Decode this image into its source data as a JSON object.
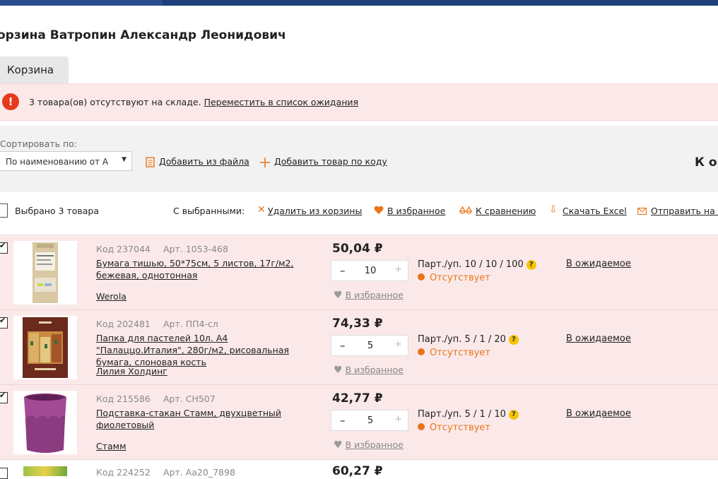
{
  "page": {
    "title": "орзина Ватропин Александр Леонидович",
    "tab_label": "Корзина"
  },
  "alert": {
    "icon": "!",
    "text": "3 товара(ов) отсутствуют на складе.",
    "link": "Переместить в список ожидания"
  },
  "toolbar": {
    "sort_label": "Сортировать по:",
    "sort_value": "По наименованию от А",
    "add_from_file": "Добавить из файла",
    "add_by_code": "Добавить товар по коду",
    "checkout_partial": "К оп"
  },
  "bulk": {
    "selected_count": "Выбрано 3 товара",
    "with_selected": "С выбранными:",
    "remove": "Удалить из корзины",
    "to_favorites": "В избранное",
    "to_compare": "К сравнению",
    "download_excel": "Скачать Excel",
    "send": "Отправить на В"
  },
  "items": [
    {
      "code": "Код 237044",
      "art": "Арт. 1053-468",
      "name": "Бумага тишью, 50*75см, 5 листов, 17г/м2, бежевая, однотонная",
      "brand": "Werola",
      "price": "50,04 ₽",
      "qty": "10",
      "pack": "Парт./уп. 10 / 10 / 100",
      "status": "Отсутствует",
      "favorite": "В избранное",
      "wait": "В ожидаемое"
    },
    {
      "code": "Код 202481",
      "art": "Арт. ПП4-сл",
      "name": "Папка для пастелей 10л. А4 \"Палаццо.Италия\", 280г/м2, рисовальная бумага, слоновая кость",
      "brand": "Лилия Холдинг",
      "price": "74,33 ₽",
      "qty": "5",
      "pack": "Парт./уп. 5 / 1 / 20",
      "status": "Отсутствует",
      "favorite": "В избранное",
      "wait": "В ожидаемое"
    },
    {
      "code": "Код 215586",
      "art": "Арт. CH507",
      "name": "Подставка-стакан Стамм, двухцветный фиолетовый",
      "brand": "Стамм",
      "price": "42,77 ₽",
      "qty": "5",
      "pack": "Парт./уп. 5 / 1 / 10",
      "status": "Отсутствует",
      "favorite": "В избранное",
      "wait": "В ожидаемое"
    }
  ],
  "partial_item": {
    "code": "Код 224252",
    "art": "Арт. Аа20_7898",
    "price": "60,27 ₽"
  },
  "colors": {
    "accent": "#e8751a",
    "alert_bg": "#fbe9ea",
    "header": "#1f3f7a"
  },
  "icons": {
    "alert": "exclamation-icon",
    "file": "file-icon",
    "plus": "plus-icon",
    "remove": "cross-icon",
    "heart": "heart-icon",
    "compare": "scales-icon",
    "download": "download-arrow-icon",
    "mail": "envelope-icon",
    "help": "question-icon"
  }
}
